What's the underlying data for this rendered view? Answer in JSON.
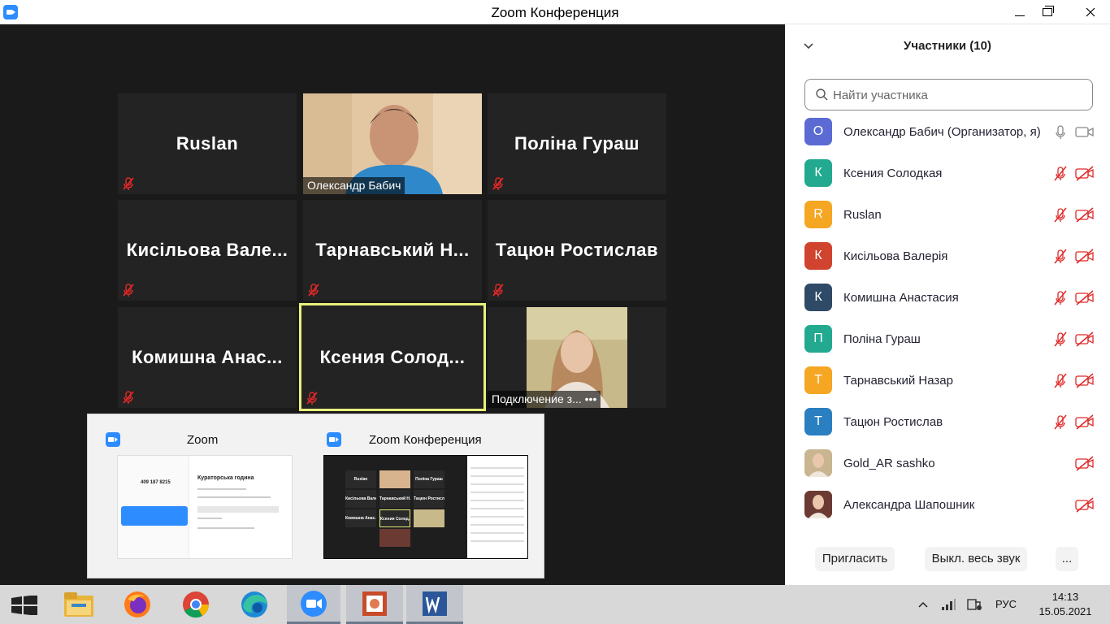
{
  "window": {
    "title": "Zoom Конференция"
  },
  "tiles": [
    {
      "name": "Ruslan",
      "muted": true
    },
    {
      "name": "Олександр Бабич",
      "video": true
    },
    {
      "name": "Поліна Гураш",
      "muted": true
    },
    {
      "name": "Кисільова Вале...",
      "muted": true
    },
    {
      "name": "Тарнавський Н...",
      "muted": true
    },
    {
      "name": "Тацюн Ростислав",
      "muted": true
    },
    {
      "name": "Комишна Анас...",
      "muted": true
    },
    {
      "name": "Ксения Солод...",
      "muted": true,
      "active_speaker": true
    },
    {
      "name": "Подключение з... •••",
      "photo": true
    }
  ],
  "task_preview": {
    "left": {
      "title": "Zoom",
      "mini": {
        "meeting_number": "409 187 8215",
        "heading": "Кураторська година"
      }
    },
    "right": {
      "title": "Zoom Конференция",
      "mini_tiles": [
        "Ruslan",
        "",
        "Поліна Гураш",
        "Кисільова Вале...",
        "Тарнавський Н...",
        "Тацюн Ростислав",
        "Комишна Анас...",
        "Ксения Солод...",
        ""
      ]
    }
  },
  "panel": {
    "title": "Участники (10)",
    "search_placeholder": "Найти участника",
    "participants": [
      {
        "initial": "О",
        "name": "Олександр Бабич (Организатор, я)",
        "color": "#5b6bd3",
        "mic": "on",
        "cam": "on"
      },
      {
        "initial": "К",
        "name": " Ксения Солодкая",
        "color": "#22a98f",
        "mic": "off",
        "cam": "off"
      },
      {
        "initial": "R",
        "name": "Ruslan",
        "color": "#f5a623",
        "mic": "off",
        "cam": "off"
      },
      {
        "initial": "К",
        "name": "Кисільова Валерія",
        "color": "#d0432e",
        "mic": "off",
        "cam": "off"
      },
      {
        "initial": "К",
        "name": "Комишна Анастасия",
        "color": "#2e4a66",
        "mic": "off",
        "cam": "off"
      },
      {
        "initial": "П",
        "name": "Поліна Гураш",
        "color": "#22a98f",
        "mic": "off",
        "cam": "off"
      },
      {
        "initial": "Т",
        "name": "Тарнавський Назар",
        "color": "#f5a623",
        "mic": "off",
        "cam": "off"
      },
      {
        "initial": "Т",
        "name": "Тацюн Ростислав",
        "color": "#2a7fc0",
        "mic": "off",
        "cam": "off"
      },
      {
        "initial": "",
        "name": "Gold_AR sashko",
        "color": "#c9b58f",
        "mic": "none",
        "cam": "off"
      },
      {
        "initial": "",
        "name": "Александра Шапошник",
        "color": "#6b3a32",
        "mic": "none",
        "cam": "off"
      }
    ],
    "buttons": {
      "invite": "Пригласить",
      "mute_all": "Выкл. весь звук",
      "more": "..."
    }
  },
  "taskbar": {
    "apps": [
      "windows-start",
      "file-explorer",
      "firefox",
      "chrome",
      "edge",
      "zoom",
      "powerpoint",
      "word"
    ],
    "language": "РУС",
    "time": "14:13",
    "date": "15.05.2021"
  },
  "colors": {
    "accent": "#2d8cff",
    "muted_red": "#e02828",
    "active_speaker_border": "#e8f07a"
  }
}
